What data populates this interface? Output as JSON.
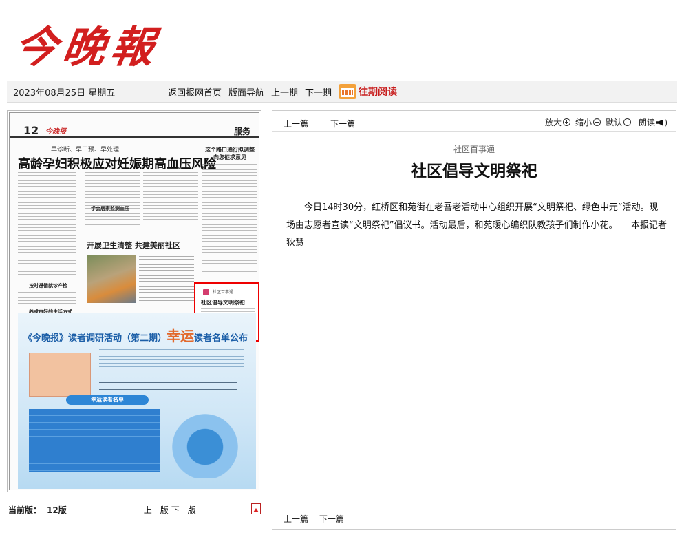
{
  "masthead": {
    "logo_text": "今晚報"
  },
  "datebar": {
    "date": "2023年08月25日 星期五",
    "links": [
      "返回报网首页",
      "版面导航",
      "上一期",
      "下一期"
    ],
    "calendar_icon": "calendar-icon",
    "past_label": "往期阅读"
  },
  "page": {
    "number": "12",
    "paper_name": "今晚报",
    "section": "服务",
    "subhead": "早诊断、早干预、早处理",
    "headline": "高龄孕妇积极应对妊娠期高血压风险",
    "side_headline": "这个路口通行拟调整\n向您征求意见",
    "sub1": "学会居家监测血压",
    "sub2": "按时遵循就诊产检",
    "sub3": "养成良好的生活方式",
    "photo_title": "开展卫生清整 共建美丽社区",
    "highlight_column": "社区百事通",
    "highlight_title": "社区倡导文明祭祀",
    "ad_title_a": "《今晚报》读者调研活动（第二期）",
    "ad_title_lucky": "幸运",
    "ad_title_b": "读者名单公布",
    "ad_winners": "幸运读者名单"
  },
  "leftfoot": {
    "current_label": "当前版：",
    "current_value": "12版",
    "prev": "上一版",
    "next": "下一版",
    "pdf_icon": "pdf-icon"
  },
  "toolbar": {
    "prev": "上一篇",
    "next": "下一篇",
    "zoom_in": "放大",
    "zoom_out": "缩小",
    "default": "默认",
    "read": "朗读"
  },
  "article": {
    "column": "社区百事通",
    "title": "社区倡导文明祭祀",
    "body": "今日14时30分，红桥区和苑街在老吾老活动中心组织开展“文明祭祀、绿色中元”活动。现场由志愿者宣读“文明祭祀”倡议书。活动最后，和苑暖心编织队教孩子们制作小花。　　本报记者　狄慧"
  },
  "bottomnav": {
    "prev": "上一篇",
    "next": "下一篇"
  }
}
